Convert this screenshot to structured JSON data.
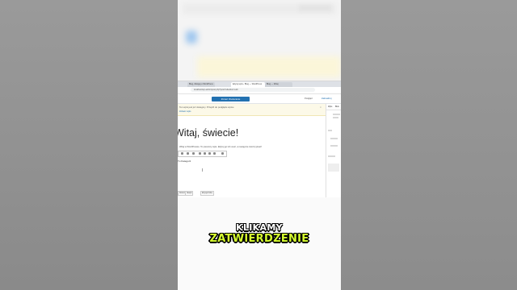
{
  "browser": {
    "tabs": [
      {
        "label": "Blog, Zaloguj o WordPress"
      },
      {
        "label": "Edytuj wpis ‹ Blog — WordPress"
      },
      {
        "label": "Blog — Witaj"
      }
    ],
    "url": "localhost/wp-admin/post.php?post=1&action=edit"
  },
  "editor": {
    "toolbar_button": "Zmień Otwieranie",
    "preview_label": "Podgląd",
    "publish_label": "Zaktualizuj",
    "notice_text": "Ten wpis jest już dostępny. Przejdź do podglądu wpisu.",
    "notice_link": "Zobacz wpis",
    "notice_close": "×",
    "post_title": "Witaj, świecie!",
    "paragraph_text": "Witaj w WordPressie. To pierwszy wpis. Edytuj go lub usuń, a następnie zacznij pisać!",
    "block2_text": "Tu Kategorii",
    "cursor": "I",
    "sidebar_tabs": [
      "Wpis",
      "Blok"
    ],
    "footer_crumbs": [
      "Dokument",
      "Akapit",
      "Edycja bloku"
    ]
  },
  "caption": {
    "line1": "KLIKAMY",
    "line2": "ZATWIERDZENIE"
  }
}
